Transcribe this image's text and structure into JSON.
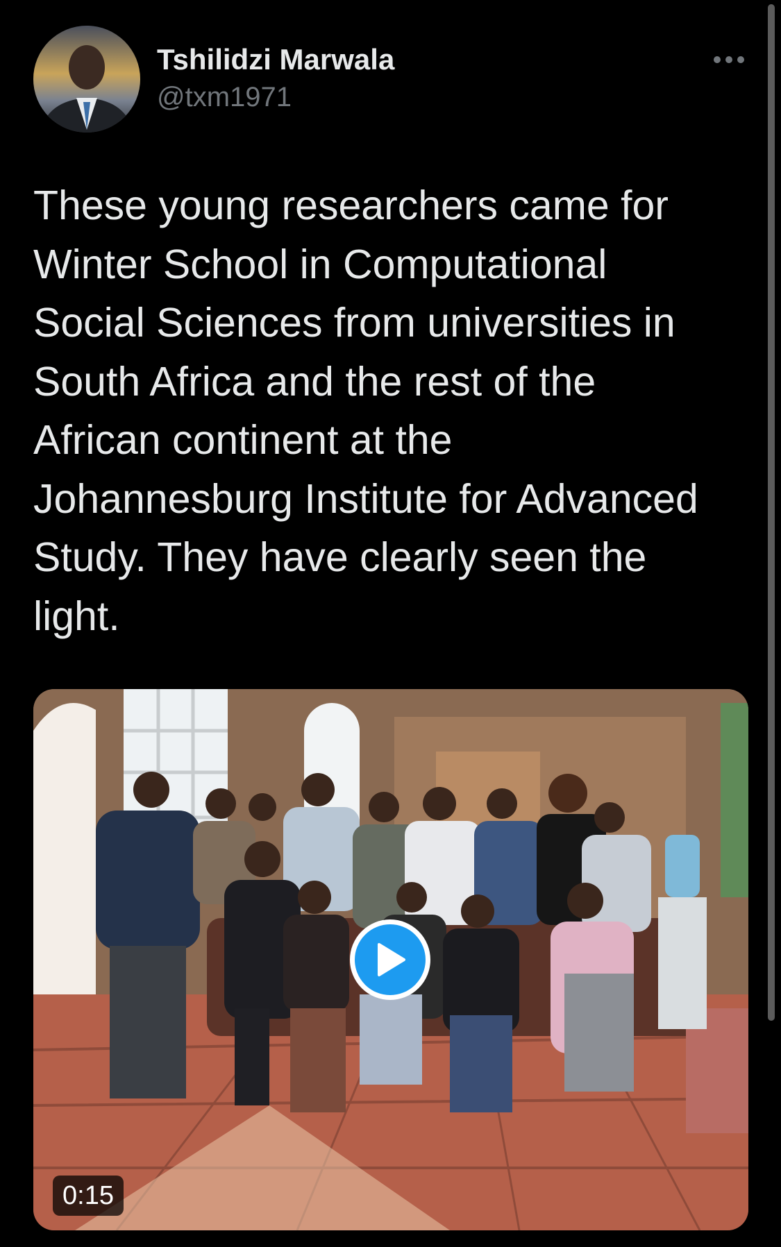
{
  "author": {
    "display_name": "Tshilidzi Marwala",
    "handle": "@txm1971",
    "avatar_icon": "profile-photo"
  },
  "more_icon": "ellipsis-icon",
  "tweet": {
    "text": "These young researchers came for\nWinter School in Computational\nSocial Sciences from universities in\nSouth Africa and the rest of the\nAfrican continent at the\nJohannesburg Institute for Advanced\nStudy. They have clearly seen the\nlight."
  },
  "media": {
    "type": "video",
    "duration": "0:15",
    "play_icon": "play-icon"
  },
  "colors": {
    "background": "#000000",
    "text": "#e7e9ea",
    "secondary_text": "#71767b",
    "accent": "#1d9bf0"
  }
}
